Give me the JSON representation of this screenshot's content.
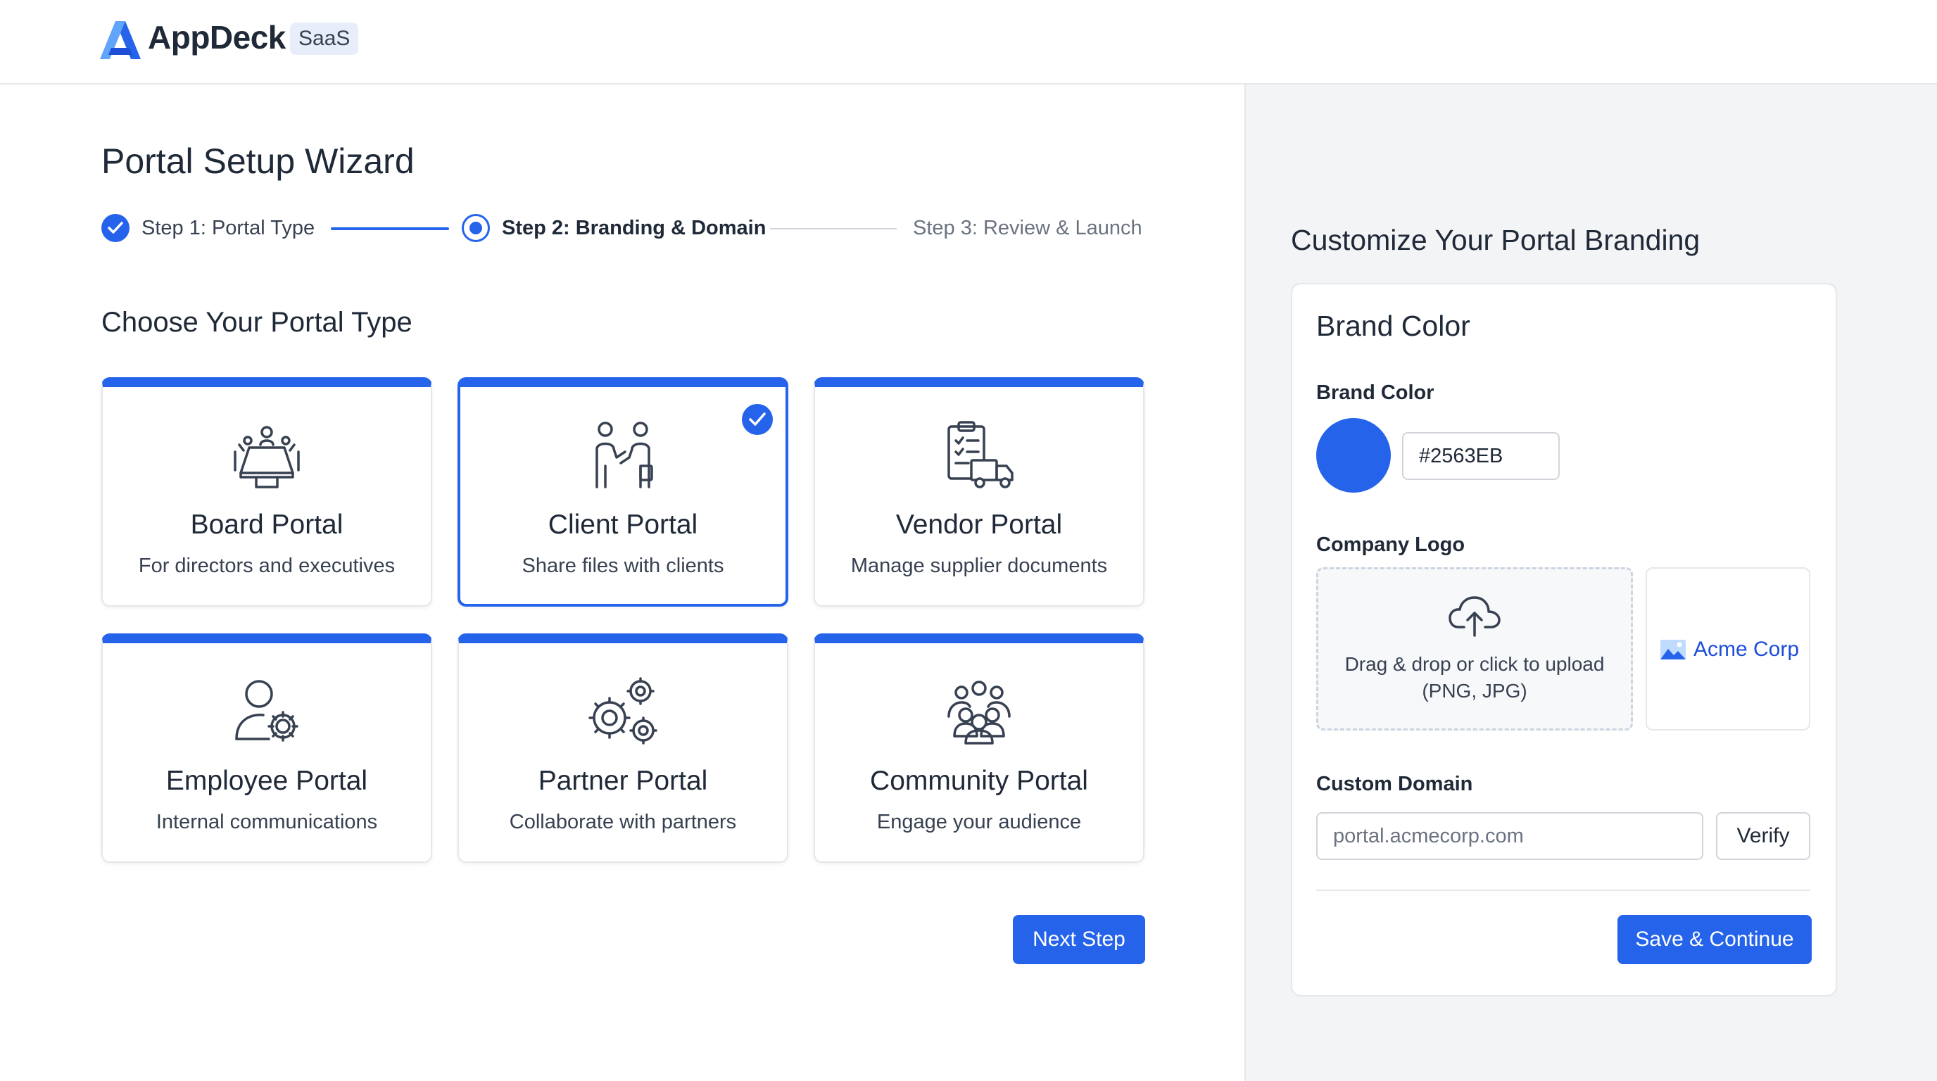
{
  "app": {
    "name": "AppDeck",
    "badge": "SaaS"
  },
  "colors": {
    "accent": "#2563EB",
    "text": "#1F2937",
    "muted": "#6B7280"
  },
  "wizard": {
    "title": "Portal Setup Wizard",
    "steps": [
      {
        "label": "Step 1: Portal Type",
        "state": "complete"
      },
      {
        "label": "Step 2: Branding & Domain",
        "state": "current"
      },
      {
        "label": "Step 3: Review & Launch",
        "state": "upcoming"
      }
    ],
    "section_title": "Choose Your Portal Type",
    "portal_types": [
      {
        "title": "Board Portal",
        "desc": "For directors and executives",
        "icon": "boardroom-icon",
        "selected": false
      },
      {
        "title": "Client Portal",
        "desc": "Share files with clients",
        "icon": "handshake-icon",
        "selected": true
      },
      {
        "title": "Vendor Portal",
        "desc": "Manage supplier documents",
        "icon": "clipboard-truck-icon",
        "selected": false
      },
      {
        "title": "Employee Portal",
        "desc": "Internal communications",
        "icon": "user-gear-icon",
        "selected": false
      },
      {
        "title": "Partner Portal",
        "desc": "Collaborate with partners",
        "icon": "gears-icon",
        "selected": false
      },
      {
        "title": "Community Portal",
        "desc": "Engage your audience",
        "icon": "group-icon",
        "selected": false
      }
    ],
    "next_label": "Next Step"
  },
  "branding": {
    "panel_title": "Customize Your Portal Branding",
    "card_title": "Brand Color",
    "color_label": "Brand Color",
    "color_value": "#2563EB",
    "logo_label": "Company Logo",
    "upload_text": "Drag & drop or click to upload (PNG, JPG)",
    "logo_preview_text": "Acme Corp",
    "domain_label": "Custom Domain",
    "domain_placeholder": "portal.acmecorp.com",
    "verify_label": "Verify",
    "save_label": "Save & Continue"
  }
}
